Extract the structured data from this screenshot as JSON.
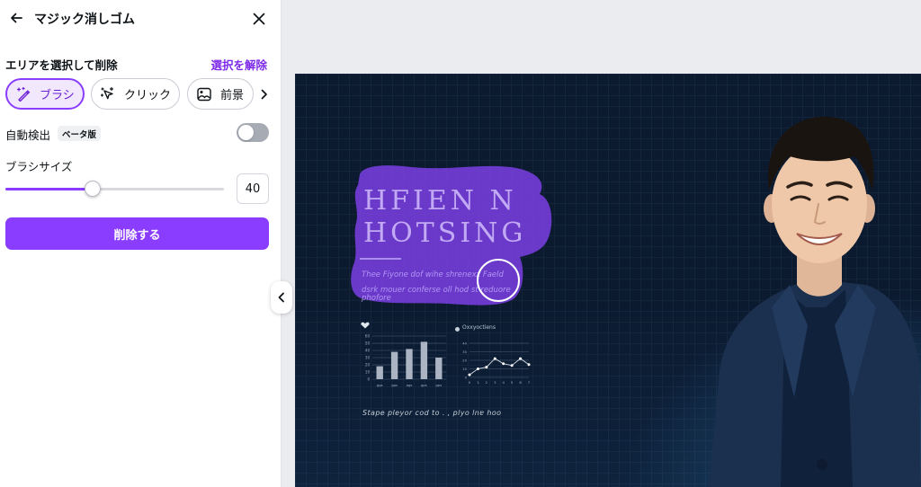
{
  "header": {
    "title": "マジック消しゴム"
  },
  "select_section": {
    "title": "エリアを選択して削除",
    "deselect_label": "選択を解除"
  },
  "tools": [
    {
      "label": "ブラシ",
      "active": true
    },
    {
      "label": "クリック",
      "active": false
    },
    {
      "label": "前景",
      "active": false
    }
  ],
  "auto_detect": {
    "label": "自動検出",
    "badge": "ベータ版",
    "enabled": false
  },
  "brush_size": {
    "label": "ブラシサイズ",
    "value": "40",
    "slider_fraction": 0.4
  },
  "erase_button": {
    "label": "削除する"
  },
  "colors": {
    "accent": "#8b3dff",
    "accent_light": "#f1e8fd",
    "canvas_bg": "#0c1a30",
    "mask": "#7b3fe4"
  },
  "canvas": {
    "headline_line1": "HFIEN N",
    "headline_line2": "HOTSING",
    "sub_line1": "Thee Fiyone dof wihe shrenexz Faeld",
    "sub_line2": "dsrk mouer conferse oll hod st reduore",
    "sub_line3": "phofore",
    "bar_chart": {
      "values": [
        18,
        38,
        42,
        52,
        30
      ],
      "ylim": [
        0,
        60
      ],
      "y_ticks": [
        "0",
        "10",
        "20",
        "30",
        "40",
        "50",
        "60"
      ],
      "x_ticks": [
        "ggs",
        "gps",
        "ags",
        "gps",
        "gps"
      ]
    },
    "line_chart": {
      "caption": "Oxxyoctiens",
      "values": [
        3,
        10,
        12,
        22,
        16,
        14,
        22,
        15
      ],
      "ylim": [
        0,
        40
      ],
      "y_ticks": [
        "0",
        "10",
        "20",
        "30",
        "40"
      ],
      "x_ticks": [
        "0",
        "1",
        "2",
        "3",
        "4",
        "5",
        "6",
        "7"
      ]
    },
    "footer_text": "Stape pleyor cod to . , plyo lnɐ hoo"
  }
}
